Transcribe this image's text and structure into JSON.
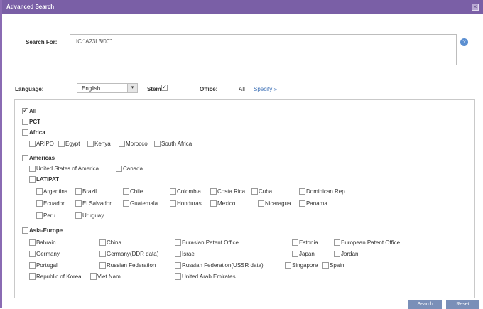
{
  "dialog": {
    "title": "Advanced Search",
    "close_symbol": "×"
  },
  "search": {
    "label": "Search For:",
    "value": "IC:\"A23L3/00\"",
    "help_symbol": "?"
  },
  "language": {
    "label": "Language:",
    "value": "English",
    "arrow": "▾"
  },
  "stem": {
    "label": "Stem:",
    "checked": true
  },
  "office": {
    "label": "Office:",
    "value": "All",
    "specify_link": "Specify »"
  },
  "offices": {
    "all": "All",
    "pct": "PCT",
    "africa": "Africa",
    "aripo": "ARIPO",
    "egypt": "Egypt",
    "kenya": "Kenya",
    "morocco": "Morocco",
    "south_africa": "South Africa",
    "americas": "Americas",
    "usa": "United States of America",
    "canada": "Canada",
    "latipat": "LATIPAT",
    "argentina": "Argentina",
    "brazil": "Brazil",
    "chile": "Chile",
    "colombia": "Colombia",
    "costa_rica": "Costa Rica",
    "cuba": "Cuba",
    "dominican_rep": "Dominican Rep.",
    "ecuador": "Ecuador",
    "el_salvador": "El Salvador",
    "guatemala": "Guatemala",
    "honduras": "Honduras",
    "mexico": "Mexico",
    "nicaragua": "Nicaragua",
    "panama": "Panama",
    "peru": "Peru",
    "uruguay": "Uruguay",
    "asia_europe": "Asia-Europe",
    "bahrain": "Bahrain",
    "china": "China",
    "eurasian": "Eurasian Patent Office",
    "estonia": "Estonia",
    "epo": "European Patent Office",
    "germany": "Germany",
    "germany_ddr": "Germany(DDR data)",
    "israel": "Israel",
    "japan": "Japan",
    "jordan": "Jordan",
    "portugal": "Portugal",
    "russia": "Russian Federation",
    "russia_ussr": "Russian Federation(USSR data)",
    "singapore": "Singapore",
    "spain": "Spain",
    "korea": "Republic of Korea",
    "vietnam": "Viet Nam",
    "uae": "United Arab Emirates"
  },
  "buttons": {
    "search": "Search",
    "reset": "Reset"
  }
}
